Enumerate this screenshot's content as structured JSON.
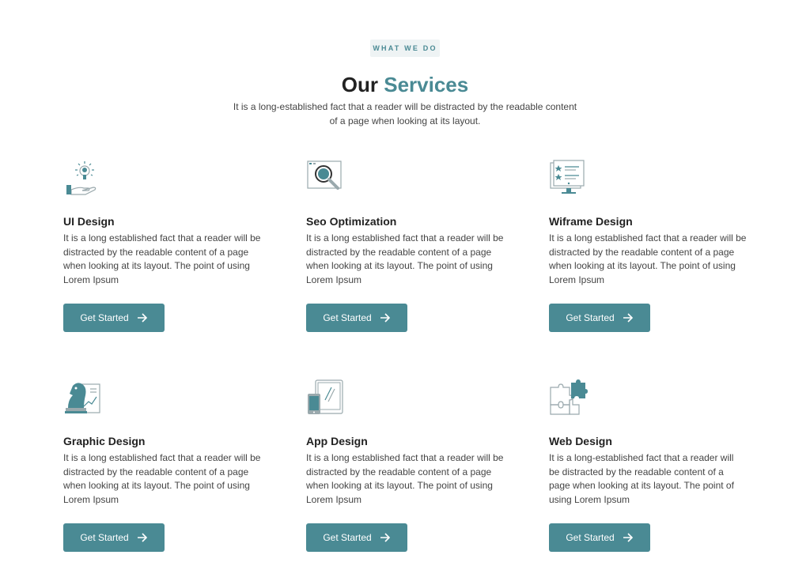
{
  "header": {
    "eyebrow": "WHAT WE DO",
    "title_plain": "Our ",
    "title_accent": "Services",
    "subtitle": "It is a long-established fact that a reader will be distracted by the readable content of a page when looking at its layout."
  },
  "colors": {
    "accent": "#4a8a94",
    "heading": "#222222",
    "text": "#444444",
    "eyebrow_bg": "#eef3f4"
  },
  "services": [
    {
      "title": "UI Design",
      "icon": "lightbulb-hand-icon",
      "description": "It is a long established fact that a reader will be distracted by the readable content of a page when looking at its layout. The point of using Lorem Ipsum",
      "button": "Get Started"
    },
    {
      "title": "Seo Optimization",
      "icon": "magnifier-icon",
      "description": "It is a long established fact that a reader will be distracted by the readable content of a page when looking at its layout. The point of using Lorem Ipsum",
      "button": "Get Started"
    },
    {
      "title": "Wiframe Design",
      "icon": "wireframe-monitor-icon",
      "description": "It is a long established fact that a reader will be distracted by the readable content of a page when looking at its layout. The point of using Lorem Ipsum",
      "button": "Get Started"
    },
    {
      "title": "Graphic Design",
      "icon": "chess-knight-icon",
      "description": "It is a long established fact that a reader will be distracted by the readable content of a page when looking at its layout. The point of using Lorem Ipsum",
      "button": "Get Started"
    },
    {
      "title": "App Design",
      "icon": "tablet-phone-icon",
      "description": "It is a long established fact that a reader will be distracted by the readable content of a page when looking at its layout. The point of using Lorem Ipsum",
      "button": "Get Started"
    },
    {
      "title": "Web Design",
      "icon": "puzzle-icon",
      "description": "It is a long-established fact that a reader will be distracted by the readable content of a page when looking at its layout. The point of using Lorem Ipsum",
      "button": "Get Started"
    }
  ]
}
